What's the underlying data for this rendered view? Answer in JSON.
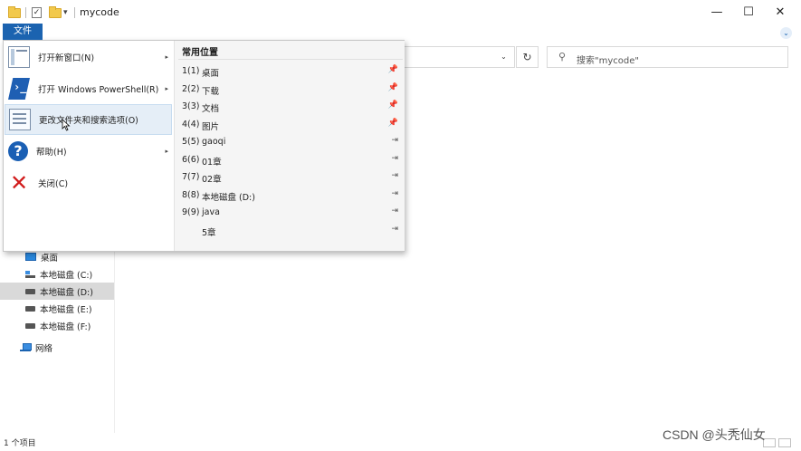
{
  "window": {
    "title": "mycode",
    "controls": {
      "minimize": "—",
      "maximize": "☐",
      "close": "✕"
    }
  },
  "quick_access": {
    "customize_glyph": "▾"
  },
  "ribbon": {
    "file_tab": "文件"
  },
  "address": {
    "dropdown_glyph": "⌄",
    "refresh_glyph": "↻"
  },
  "search": {
    "placeholder": "搜索\"mycode\"",
    "icon_glyph": "⚲"
  },
  "file_menu": {
    "items": [
      {
        "label": "打开新窗口(N)",
        "icon": "new-window-icon",
        "has_submenu": true
      },
      {
        "label": "打开 Windows PowerShell(R)",
        "icon": "powershell-icon",
        "has_submenu": true
      },
      {
        "label": "更改文件夹和搜索选项(O)",
        "icon": "folder-options-icon",
        "has_submenu": false
      },
      {
        "label": "帮助(H)",
        "icon": "help-icon",
        "has_submenu": true
      },
      {
        "label": "关闭(C)",
        "icon": "close-icon",
        "has_submenu": false
      }
    ],
    "submenu_arrow": "▸",
    "help_glyph": "?",
    "close_glyph": "✕"
  },
  "recent": {
    "title": "常用位置",
    "items": [
      {
        "num": "1(1)",
        "name": "桌面",
        "pin": "📌"
      },
      {
        "num": "2(2)",
        "name": "下载",
        "pin": "📌"
      },
      {
        "num": "3(3)",
        "name": "文档",
        "pin": "📌"
      },
      {
        "num": "4(4)",
        "name": "图片",
        "pin": "📌"
      },
      {
        "num": "5(5)",
        "name": "gaoqi",
        "pin": "⇥"
      },
      {
        "num": "6(6)",
        "name": "01章",
        "pin": "⇥"
      },
      {
        "num": "7(7)",
        "name": "02章",
        "pin": "⇥"
      },
      {
        "num": "8(8)",
        "name": "本地磁盘 (D:)",
        "pin": "⇥"
      },
      {
        "num": "9(9)",
        "name": "java",
        "pin": "⇥"
      },
      {
        "num": "",
        "name": "5章",
        "pin": "⇥"
      }
    ]
  },
  "nav_pane": {
    "items": [
      {
        "label": "桌面",
        "icon": "desktop-icon"
      },
      {
        "label": "本地磁盘 (C:)",
        "icon": "system-drive-icon"
      },
      {
        "label": "本地磁盘 (D:)",
        "icon": "drive-icon",
        "selected": true
      },
      {
        "label": "本地磁盘 (E:)",
        "icon": "drive-icon"
      },
      {
        "label": "本地磁盘 (F:)",
        "icon": "drive-icon"
      },
      {
        "label": "网络",
        "icon": "network-icon"
      }
    ]
  },
  "status": {
    "item_count": "1 个项目"
  },
  "watermark": "CSDN @头秃仙女",
  "colors": {
    "accent": "#1b63b0",
    "hover": "#e5eef7",
    "selected": "#d9d9d9",
    "close_red": "#d11b1b"
  }
}
